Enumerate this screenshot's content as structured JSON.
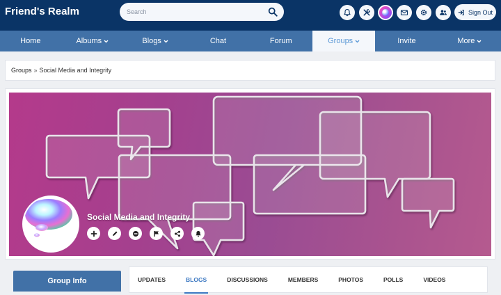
{
  "header": {
    "site_name": "Friend's Realm",
    "search": {
      "placeholder": "Search",
      "icon": "search-icon"
    },
    "icons": [
      "notifications-icon",
      "tools-icon",
      "user-avatar",
      "messages-icon",
      "settings-icon",
      "friends-icon"
    ],
    "sign_out": {
      "label": "Sign Out",
      "icon": "sign-out-icon"
    }
  },
  "nav": {
    "items": [
      {
        "label": "Home",
        "dropdown": false
      },
      {
        "label": "Albums",
        "dropdown": true
      },
      {
        "label": "Blogs",
        "dropdown": true
      },
      {
        "label": "Chat",
        "dropdown": false
      },
      {
        "label": "Forum",
        "dropdown": false
      },
      {
        "label": "Groups",
        "dropdown": true,
        "active": true
      },
      {
        "label": "Invite",
        "dropdown": false
      },
      {
        "label": "More",
        "dropdown": true
      }
    ]
  },
  "breadcrumb": {
    "root": "Groups",
    "separator": "»",
    "current": "Social Media and Integrity"
  },
  "group": {
    "title": "Social Media and Integrity",
    "actions": [
      "add-icon",
      "edit-icon",
      "leave-icon",
      "report-flag-icon",
      "share-icon",
      "subscribe-bell-icon"
    ]
  },
  "sidebar": {
    "info_title": "Group Info"
  },
  "tabs": [
    {
      "label": "UPDATES",
      "active": false
    },
    {
      "label": "BLOGS",
      "active": true
    },
    {
      "label": "DISCUSSIONS",
      "active": false
    },
    {
      "label": "MEMBERS",
      "active": false
    },
    {
      "label": "PHOTOS",
      "active": false
    },
    {
      "label": "POLLS",
      "active": false
    },
    {
      "label": "VIDEOS",
      "active": false
    }
  ],
  "colors": {
    "header_bg": "#0a3466",
    "nav_bg": "#4171a7",
    "nav_active_text": "#5a98d6",
    "tab_active": "#3d79c2",
    "cover_magenta": "#a4408e"
  }
}
